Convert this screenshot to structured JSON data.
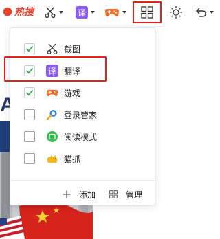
{
  "background": {
    "badge_text": "热搜",
    "partial_letter": "A"
  },
  "toolbar": {
    "scissors": "scissors-icon",
    "translate_glyph": "译",
    "game": "gamepad-icon",
    "apps": "grid-icon",
    "brightness": "sun-icon",
    "undo": "undo-icon"
  },
  "menu": {
    "items": [
      {
        "label": "截图",
        "checked": true,
        "icon": "scissors-icon"
      },
      {
        "label": "翻译",
        "checked": true,
        "icon": "translate-icon",
        "glyph": "译"
      },
      {
        "label": "游戏",
        "checked": true,
        "icon": "gamepad-icon"
      },
      {
        "label": "登录管家",
        "checked": false,
        "icon": "search-icon"
      },
      {
        "label": "阅读模式",
        "checked": false,
        "icon": "reader-icon"
      },
      {
        "label": "猫抓",
        "checked": false,
        "icon": "cat-icon"
      }
    ],
    "add_label": "添加",
    "manage_label": "管理"
  },
  "colors": {
    "accent_red": "#e3211b",
    "check_green": "#34a853",
    "translate_purple": "#8c5cf5",
    "game_orange": "#f06a2a",
    "reader_green": "#2cc04a",
    "search_blue": "#2f86e8",
    "cat_yellow": "#f2b91d"
  }
}
